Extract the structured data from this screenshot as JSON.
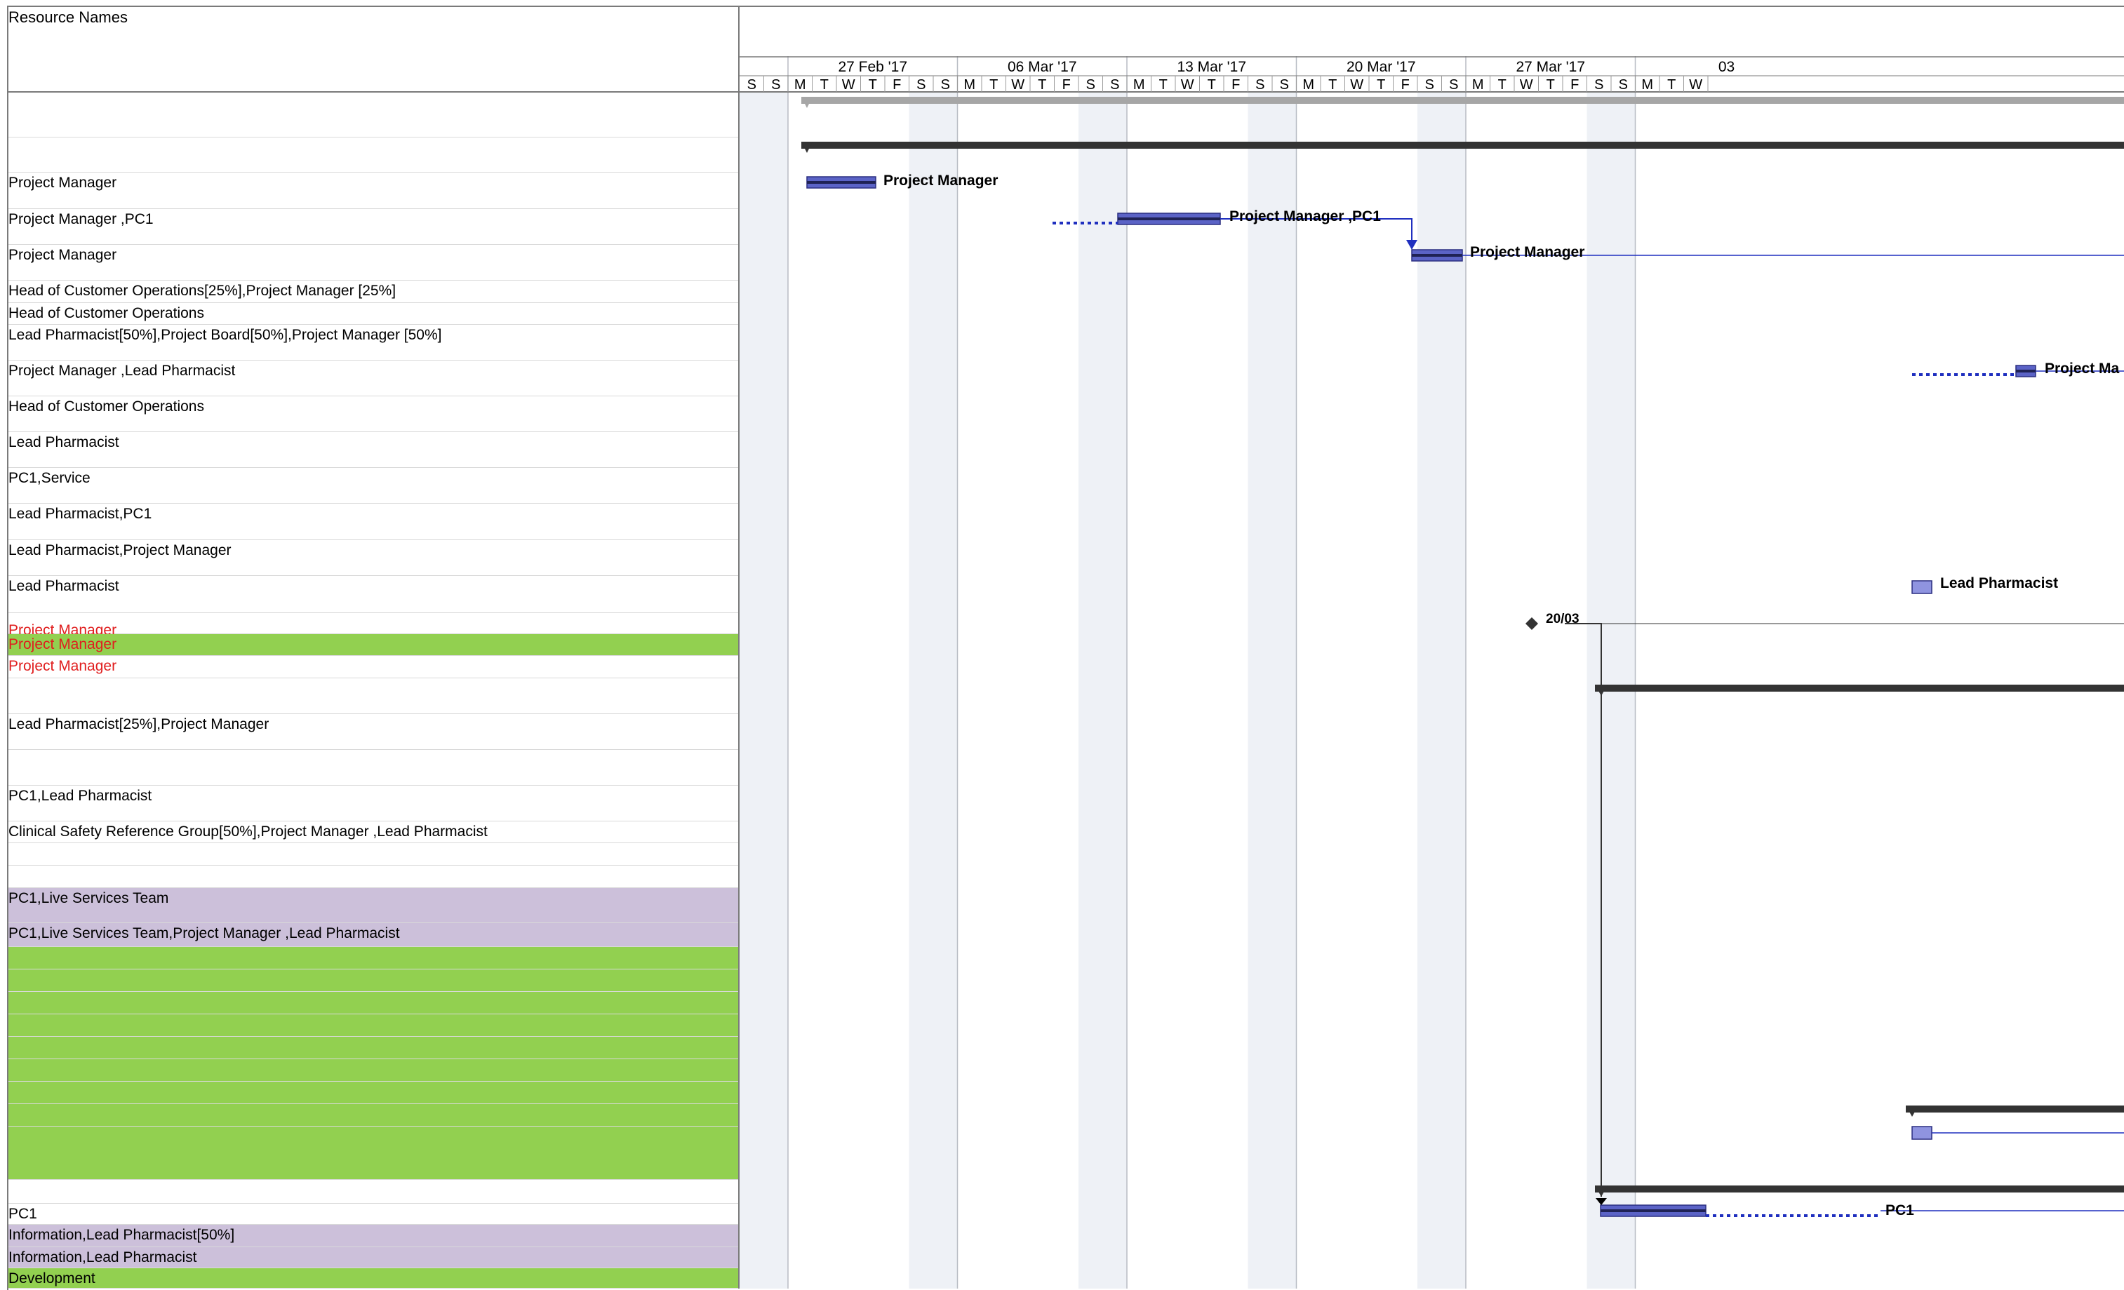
{
  "table": {
    "column_header": "Resource Names",
    "rows": [
      {
        "label": "",
        "style": "plain"
      },
      {
        "label": "",
        "style": "plain"
      },
      {
        "label": "Project Manager",
        "style": "plain"
      },
      {
        "label": "Project Manager ,PC1",
        "style": "plain"
      },
      {
        "label": "Project Manager",
        "style": "plain"
      },
      {
        "label": "Head of Customer Operations[25%],Project Manager [25%]",
        "style": "plain"
      },
      {
        "label": "Head of Customer Operations",
        "style": "plain"
      },
      {
        "label": "Lead Pharmacist[50%],Project Board[50%],Project Manager [50%]",
        "style": "plain"
      },
      {
        "label": "Project Manager ,Lead Pharmacist",
        "style": "plain"
      },
      {
        "label": "Head of Customer Operations",
        "style": "plain"
      },
      {
        "label": "Lead Pharmacist",
        "style": "plain"
      },
      {
        "label": "PC1,Service",
        "style": "plain"
      },
      {
        "label": "Lead Pharmacist,PC1",
        "style": "plain"
      },
      {
        "label": "Lead Pharmacist,Project Manager",
        "style": "plain"
      },
      {
        "label": "Lead Pharmacist",
        "style": "plain"
      },
      {
        "label": "Project Manager",
        "style": "red"
      },
      {
        "label": "Project Manager",
        "style": "red-green"
      },
      {
        "label": "Project Manager",
        "style": "red"
      },
      {
        "label": "",
        "style": "plain"
      },
      {
        "label": "Lead Pharmacist[25%],Project Manager",
        "style": "plain"
      },
      {
        "label": "",
        "style": "plain"
      },
      {
        "label": "PC1,Lead Pharmacist",
        "style": "plain"
      },
      {
        "label": "Clinical Safety Reference Group[50%],Project Manager ,Lead Pharmacist",
        "style": "plain"
      },
      {
        "label": "",
        "style": "plain"
      },
      {
        "label": "",
        "style": "plain"
      },
      {
        "label": "PC1,Live Services Team",
        "style": "purple"
      },
      {
        "label": "PC1,Live Services Team,Project Manager ,Lead Pharmacist",
        "style": "purple"
      },
      {
        "label": "",
        "style": "green"
      },
      {
        "label": "",
        "style": "green"
      },
      {
        "label": "",
        "style": "green"
      },
      {
        "label": "",
        "style": "green"
      },
      {
        "label": "",
        "style": "green"
      },
      {
        "label": "",
        "style": "green"
      },
      {
        "label": "",
        "style": "green"
      },
      {
        "label": "",
        "style": "green"
      },
      {
        "label": "",
        "style": "green"
      },
      {
        "label": "",
        "style": "green"
      },
      {
        "label": "",
        "style": "plain"
      },
      {
        "label": "PC1",
        "style": "plain"
      },
      {
        "label": "Information,Lead Pharmacist[50%]",
        "style": "purple"
      },
      {
        "label": "Information,Lead Pharmacist",
        "style": "purple"
      },
      {
        "label": "Development",
        "style": "green"
      }
    ]
  },
  "timeline": {
    "weeks": [
      "27 Feb '17",
      "06 Mar '17",
      "13 Mar '17",
      "20 Mar '17",
      "27 Mar '17",
      "03"
    ],
    "day_letters": [
      "S",
      "S",
      "M",
      "T",
      "W",
      "T",
      "F",
      "S",
      "S",
      "M",
      "T",
      "W",
      "T",
      "F",
      "S",
      "S",
      "M",
      "T",
      "W",
      "T",
      "F",
      "S",
      "S",
      "M",
      "T",
      "W",
      "T",
      "F",
      "S",
      "S",
      "M",
      "T",
      "W",
      "T",
      "F",
      "S",
      "S",
      "M",
      "T",
      "W"
    ],
    "bar_labels": {
      "row2": "Project Manager",
      "row3": "Project Manager ,PC1",
      "row4": "Project Manager",
      "row8": "Project Ma",
      "row14": "Lead Pharmacist",
      "milestone": "20/03",
      "pc1": "PC1"
    }
  },
  "colors": {
    "weekend_shade": "#eef1f6",
    "task_bar": "#5b63c6",
    "link_line": "#1f2fbf",
    "summary_bar": "#333333",
    "green_row": "#92d050",
    "purple_row": "#ccc0da",
    "critical_text": "#e01e1e"
  }
}
